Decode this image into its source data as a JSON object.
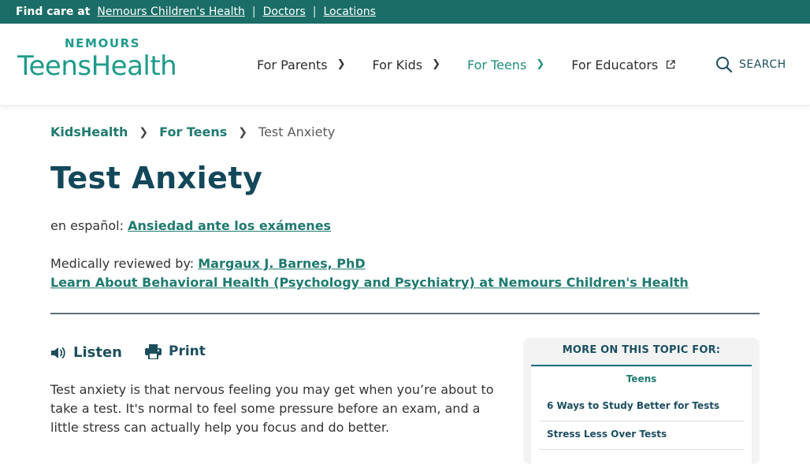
{
  "topbar": {
    "find_care": "Find care at",
    "links": [
      "Nemours Children's Health",
      "Doctors",
      "Locations"
    ],
    "separator": "|"
  },
  "logo": {
    "brand": "NEMOURS",
    "product": "TeensHealth"
  },
  "nav": {
    "items": [
      {
        "label": "For Parents",
        "icon": "chevron-right-icon"
      },
      {
        "label": "For Kids",
        "icon": "chevron-right-icon"
      },
      {
        "label": "For Teens",
        "icon": "chevron-right-icon",
        "active": true
      },
      {
        "label": "For Educators",
        "icon": "external-link-icon"
      }
    ],
    "search_label": "SEARCH"
  },
  "breadcrumb": {
    "items": [
      "KidsHealth",
      "For Teens"
    ],
    "current": "Test Anxiety"
  },
  "article": {
    "title": "Test Anxiety",
    "spanish_prefix": "en español:",
    "spanish_link": "Ansiedad ante los exámenes",
    "reviewed_prefix": "Medically reviewed by:",
    "reviewer": "Margaux J. Barnes, PhD",
    "learn_link": "Learn About Behavioral Health (Psychology and Psychiatry) at Nemours Children's Health",
    "listen_label": "Listen",
    "print_label": "Print",
    "intro": "Test anxiety is that nervous feeling you may get when you’re about to take a test. It's normal to feel some pressure before an exam, and a little stress can actually help you focus and do better."
  },
  "sidebar": {
    "heading": "MORE ON THIS TOPIC FOR:",
    "tab": "Teens",
    "links": [
      "6 Ways to Study Better for Tests",
      "Stress Less Over Tests"
    ]
  },
  "colors": {
    "topbar": "#1a6e67",
    "brand_teal": "#1f9b8a",
    "link_green": "#1f7a6f",
    "heading_navy": "#13485a"
  }
}
